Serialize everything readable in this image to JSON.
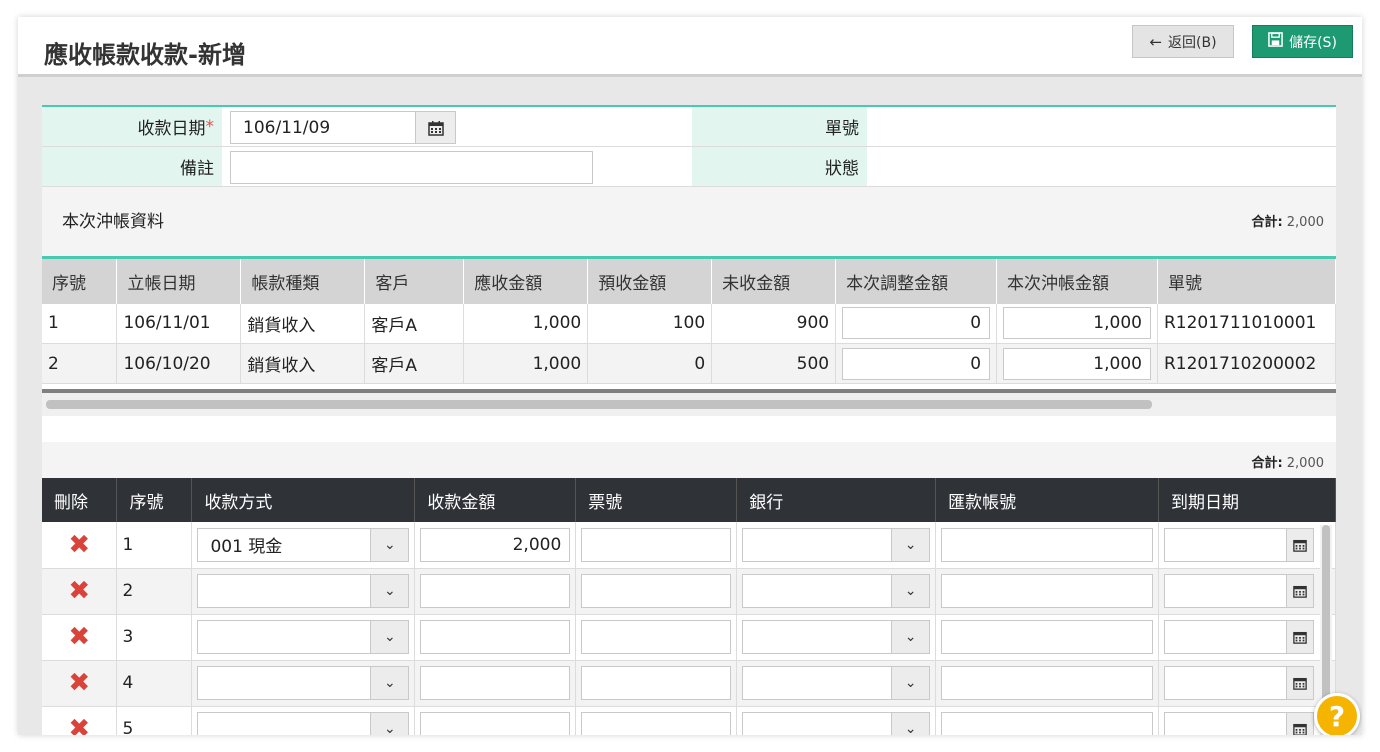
{
  "header": {
    "title": "應收帳款收款-新增",
    "back_label": "返回(B)",
    "save_label": "儲存(S)"
  },
  "form": {
    "date_label": "收款日期",
    "date_required": "*",
    "date_value": "106/11/09",
    "memo_label": "備註",
    "memo_value": "",
    "doc_no_label": "單號",
    "doc_no_value": "",
    "status_label": "狀態",
    "status_value": ""
  },
  "settle": {
    "section_title": "本次沖帳資料",
    "sum_label": "合計:",
    "sum_value": "2,000",
    "columns": [
      "序號",
      "立帳日期",
      "帳款種類",
      "客戶",
      "應收金額",
      "預收金額",
      "未收金額",
      "本次調整金額",
      "本次沖帳金額",
      "單號"
    ],
    "rows": [
      {
        "seq": "1",
        "date": "106/11/01",
        "type": "銷貨收入",
        "customer": "客戶A",
        "receivable": "1,000",
        "prepaid": "100",
        "unpaid": "900",
        "adjust": "0",
        "offset": "1,000",
        "doc": "R1201711010001"
      },
      {
        "seq": "2",
        "date": "106/10/20",
        "type": "銷貨收入",
        "customer": "客戶A",
        "receivable": "1,000",
        "prepaid": "0",
        "unpaid": "500",
        "adjust": "0",
        "offset": "1,000",
        "doc": "R1201710200002"
      }
    ]
  },
  "payment": {
    "sum_label": "合計:",
    "sum_value": "2,000",
    "columns": [
      "刪除",
      "序號",
      "收款方式",
      "收款金額",
      "票號",
      "銀行",
      "匯款帳號",
      "到期日期"
    ],
    "rows": [
      {
        "seq": "1",
        "method": "001 現金",
        "amount": "2,000"
      },
      {
        "seq": "2",
        "method": "",
        "amount": ""
      },
      {
        "seq": "3",
        "method": "",
        "amount": ""
      },
      {
        "seq": "4",
        "method": "",
        "amount": ""
      },
      {
        "seq": "5",
        "method": "",
        "amount": ""
      }
    ]
  },
  "icons": {
    "back": "arrow-left-icon",
    "save": "floppy-icon",
    "calendar": "calendar-icon",
    "delete": "x-icon",
    "dropdown": "chevron-down-icon",
    "help": "question-icon"
  },
  "colors": {
    "accent": "#48c9b0",
    "save_button": "#1e9a72",
    "delete": "#d9433a",
    "help": "#f4b400",
    "label_bg": "#e2f6ef"
  },
  "help_label": "?"
}
